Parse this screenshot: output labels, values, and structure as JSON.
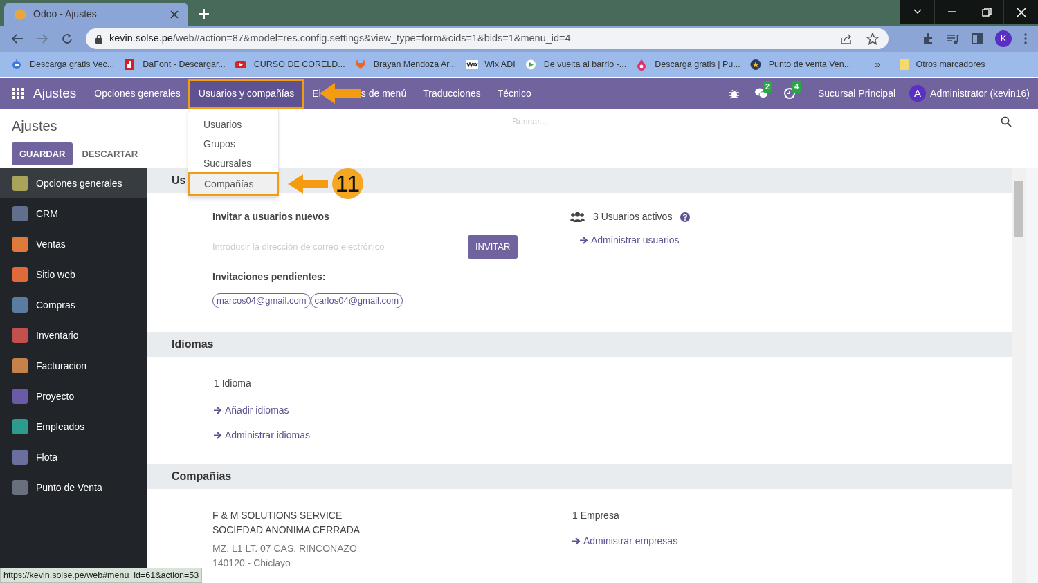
{
  "browser": {
    "tab_title": "Odoo - Ajustes",
    "url_domain": "kevin.solse.pe",
    "url_path": "/web#action=87&model=res.config.settings&view_type=form&cids=1&bids=1&menu_id=4",
    "profile": "K",
    "bookmarks": [
      {
        "kind": "robot",
        "label": "Descarga gratis Vec..."
      },
      {
        "kind": "dafont",
        "label": "DaFont - Descargar..."
      },
      {
        "kind": "youtube",
        "label": "CURSO DE CORELD..."
      },
      {
        "kind": "gitlab",
        "label": "Brayan Mendoza Ar..."
      },
      {
        "kind": "wix",
        "label": "Wix ADI"
      },
      {
        "kind": "play",
        "label": "De vuelta al barrio -..."
      },
      {
        "kind": "drop",
        "label": "Descarga gratis | Pu..."
      },
      {
        "kind": "star",
        "label": "Punto de venta Ven..."
      }
    ],
    "more": "»",
    "other_bookmarks": "Otros marcadores"
  },
  "navbar": {
    "app": "Ajustes",
    "items": [
      {
        "label": "Opciones generales",
        "selected": false
      },
      {
        "label": "Usuarios y compañías",
        "selected": true
      },
      {
        "label": "El",
        "label_end": "s de menú",
        "selected": false
      },
      {
        "label": "Traducciones",
        "selected": false
      },
      {
        "label": "Técnico",
        "selected": false
      }
    ],
    "messages": "2",
    "activities": "4",
    "company": "Sucursal Principal",
    "avatar": "A",
    "user": "Administrator (kevin16)"
  },
  "dropdown": [
    {
      "label": "Usuarios",
      "selected": false
    },
    {
      "label": "Grupos",
      "selected": false
    },
    {
      "label": "Sucursales",
      "selected": false
    },
    {
      "label": "Compañías",
      "selected": true
    }
  ],
  "annotation": {
    "number": "11"
  },
  "control_panel": {
    "title": "Ajustes",
    "save": "GUARDAR",
    "discard": "DESCARTAR",
    "search_placeholder": "Buscar..."
  },
  "sidebar": [
    {
      "label": "Opciones generales",
      "selected": true,
      "color": "#a8a45c"
    },
    {
      "label": "CRM",
      "selected": false,
      "color": "#5f6f8c"
    },
    {
      "label": "Ventas",
      "selected": false,
      "color": "#e07a3a"
    },
    {
      "label": "Sitio web",
      "selected": false,
      "color": "#e06a3a"
    },
    {
      "label": "Compras",
      "selected": false,
      "color": "#5b7ba0"
    },
    {
      "label": "Inventario",
      "selected": false,
      "color": "#c2504d"
    },
    {
      "label": "Facturacion",
      "selected": false,
      "color": "#c6824a"
    },
    {
      "label": "Proyecto",
      "selected": false,
      "color": "#6a5aa8"
    },
    {
      "label": "Empleados",
      "selected": false,
      "color": "#2e9b8f"
    },
    {
      "label": "Flota",
      "selected": false,
      "color": "#6b6f9e"
    },
    {
      "label": "Punto de Venta",
      "selected": false,
      "color": "#6a6f7e"
    }
  ],
  "users": {
    "title": "Us",
    "invite_label": "Invitar a usuarios nuevos",
    "email_placeholder": "Introducir la dirección de correo electrónico",
    "invite_button": "INVITAR",
    "pending_label": "Invitaciones pendientes:",
    "pending": [
      "marcos04@gmail.com",
      "carlos04@gmail.com"
    ],
    "active_users": "3 Usuarios activos",
    "manage_users": "Administrar usuarios"
  },
  "languages": {
    "title": "Idiomas",
    "count": "1 Idioma",
    "links": [
      "Añadir idiomas",
      "Administrar idiomas"
    ]
  },
  "companies": {
    "title": "Compañías",
    "company_lines": [
      "F & M SOLUTIONS SERVICE",
      "SOCIEDAD ANONIMA CERRADA"
    ],
    "address_lines": [
      "MZ. L1 LT. 07 CAS. RINCONAZO",
      "140120 - Chiclayo"
    ],
    "count": "1 Empresa",
    "manage": "Administrar empresas"
  },
  "status_url": "https://kevin.solse.pe/web#menu_id=61&action=53"
}
